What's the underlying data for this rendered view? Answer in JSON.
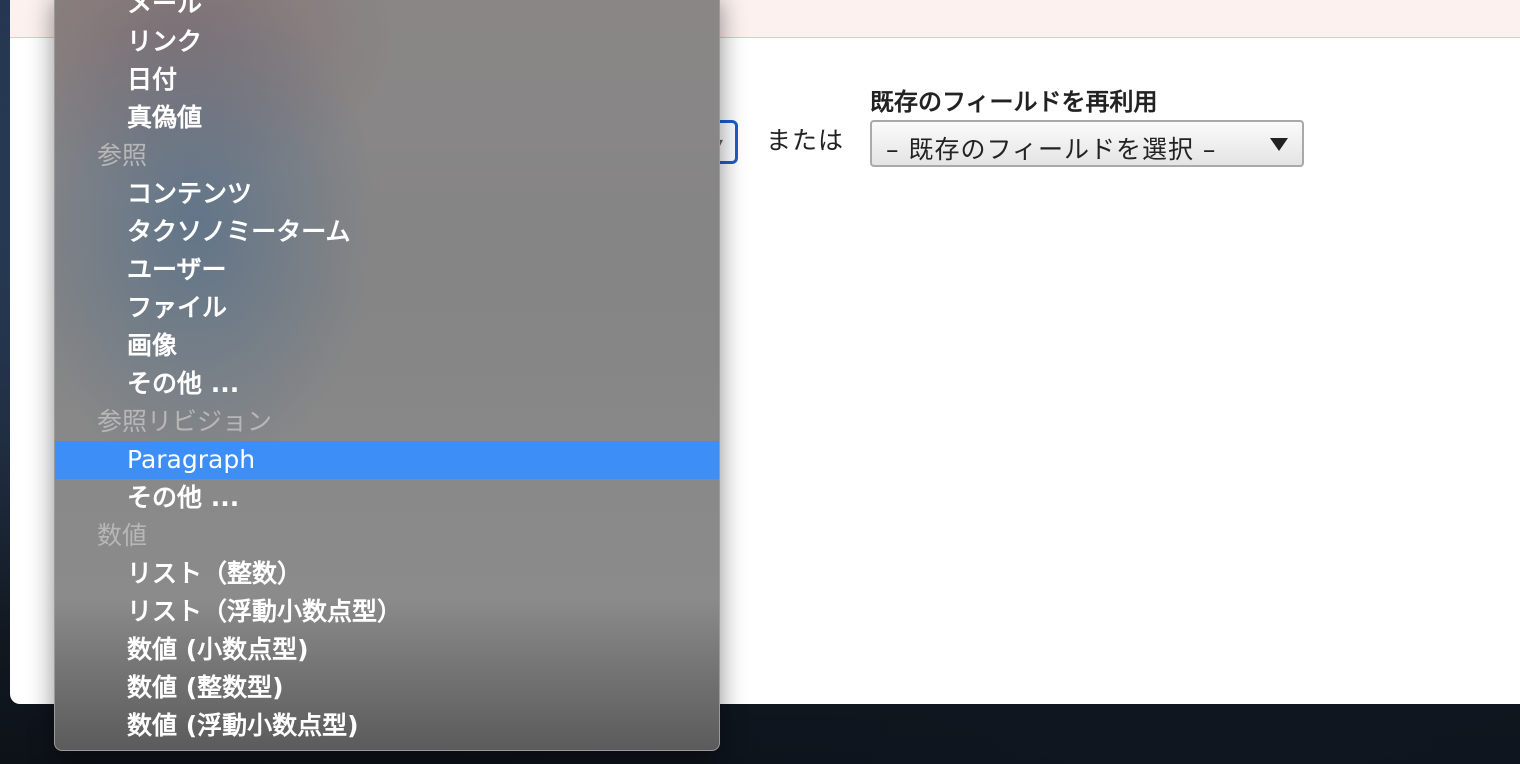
{
  "form": {
    "or_label": "または",
    "existing_field_title": "既存のフィールドを再利用",
    "existing_field_select": "– 既存のフィールドを選択 –"
  },
  "dropdown": {
    "selected_value": "Paragraph",
    "rows": [
      {
        "type": "item",
        "label": "メール"
      },
      {
        "type": "item",
        "label": "リンク"
      },
      {
        "type": "item",
        "label": "日付"
      },
      {
        "type": "item",
        "label": "真偽値"
      },
      {
        "type": "group",
        "label": "参照"
      },
      {
        "type": "item",
        "label": "コンテンツ"
      },
      {
        "type": "item",
        "label": "タクソノミーターム"
      },
      {
        "type": "item",
        "label": "ユーザー"
      },
      {
        "type": "item",
        "label": "ファイル"
      },
      {
        "type": "item",
        "label": "画像"
      },
      {
        "type": "item",
        "label": "その他 ..."
      },
      {
        "type": "group",
        "label": "参照リビジョン"
      },
      {
        "type": "item",
        "label": "Paragraph",
        "selected": true
      },
      {
        "type": "item",
        "label": "その他 ..."
      },
      {
        "type": "group",
        "label": "数値"
      },
      {
        "type": "item",
        "label": "リスト（整数）"
      },
      {
        "type": "item",
        "label": "リスト（浮動小数点型）"
      },
      {
        "type": "item",
        "label": "数値 (小数点型)"
      },
      {
        "type": "item",
        "label": "数値 (整数型)"
      },
      {
        "type": "item",
        "label": "数値 (浮動小数点型)"
      }
    ]
  },
  "colors": {
    "selection": "#3d8ff7",
    "focus_ring": "#1c5fc9",
    "error_banner": "#fcf1ef"
  }
}
